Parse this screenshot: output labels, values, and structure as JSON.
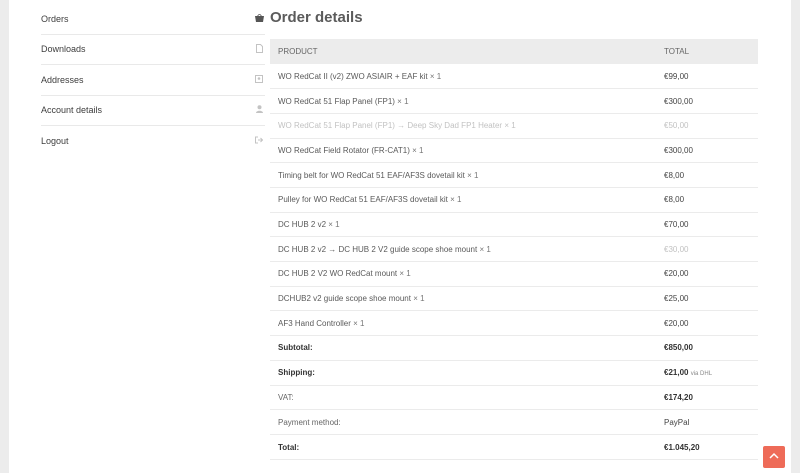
{
  "sidebar": {
    "items": [
      {
        "label": "Orders",
        "icon": "basket-icon"
      },
      {
        "label": "Downloads",
        "icon": "file-icon"
      },
      {
        "label": "Addresses",
        "icon": "address-card-icon"
      },
      {
        "label": "Account details",
        "icon": "user-icon"
      },
      {
        "label": "Logout",
        "icon": "sign-out-icon"
      }
    ]
  },
  "order": {
    "title": "Order details",
    "columns": {
      "product": "PRODUCT",
      "total": "TOTAL"
    },
    "items": [
      {
        "name": "WO RedCat II (v2) ZWO ASIAIR + EAF kit",
        "qty": "× 1",
        "total": "€99,00"
      },
      {
        "name": "WO RedCat 51 Flap Panel (FP1)",
        "qty": "× 1",
        "total": "€300,00"
      },
      {
        "name": "WO RedCat 51 Flap Panel (FP1) → Deep Sky Dad FP1 Heater",
        "qty": "× 1",
        "total": "€50,00"
      },
      {
        "name": "WO RedCat Field Rotator (FR-CAT1)",
        "qty": "× 1",
        "total": "€300,00"
      },
      {
        "name": "Timing belt for WO RedCat 51 EAF/AF3S dovetail kit",
        "qty": "× 1",
        "total": "€8,00"
      },
      {
        "name": "Pulley for WO RedCat 51 EAF/AF3S dovetail kit",
        "qty": "× 1",
        "total": "€8,00"
      },
      {
        "name": "DC HUB 2 v2",
        "qty": "× 1",
        "total": "€70,00"
      },
      {
        "name": "DC HUB 2 v2 → DC HUB 2 V2 guide scope shoe mount",
        "qty": "× 1",
        "total": "€30,00"
      },
      {
        "name": "DC HUB 2 V2 WO RedCat mount",
        "qty": "× 1",
        "total": "€20,00"
      },
      {
        "name": "DCHUB2 v2 guide scope shoe mount",
        "qty": "× 1",
        "total": "€25,00"
      },
      {
        "name": "AF3 Hand Controller",
        "qty": "× 1",
        "total": "€20,00"
      }
    ],
    "totals": [
      {
        "label": "Subtotal:",
        "value": "€850,00",
        "note": ""
      },
      {
        "label": "Shipping:",
        "value": "€21,00",
        "note": "via DHL"
      },
      {
        "label": "VAT:",
        "value": "€174,20",
        "note": ""
      },
      {
        "label": "Payment method:",
        "value": "PayPal",
        "note": ""
      },
      {
        "label": "Total:",
        "value": "€1.045,20",
        "note": ""
      }
    ]
  },
  "scroll_top": {
    "icon": "chevron-up-icon"
  }
}
